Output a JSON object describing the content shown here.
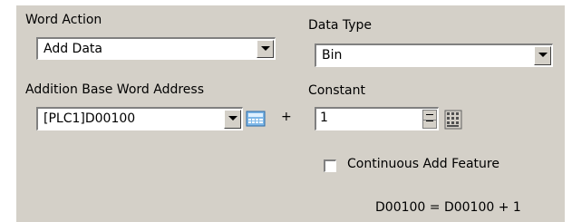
{
  "word_action": {
    "label": "Word Action",
    "value": "Add Data"
  },
  "data_type": {
    "label": "Data Type",
    "value": "Bin"
  },
  "addition_base": {
    "label": "Addition Base Word Address",
    "value": "[PLC1]D00100"
  },
  "plus_sign": "+",
  "constant": {
    "label": "Constant",
    "value": "1"
  },
  "continuous_add": {
    "label": "Continuous Add Feature",
    "checked": false
  },
  "formula": "D00100 = D00100 + 1",
  "icons": {
    "keypad": "keypad-icon",
    "calculator": "calculator-icon"
  }
}
